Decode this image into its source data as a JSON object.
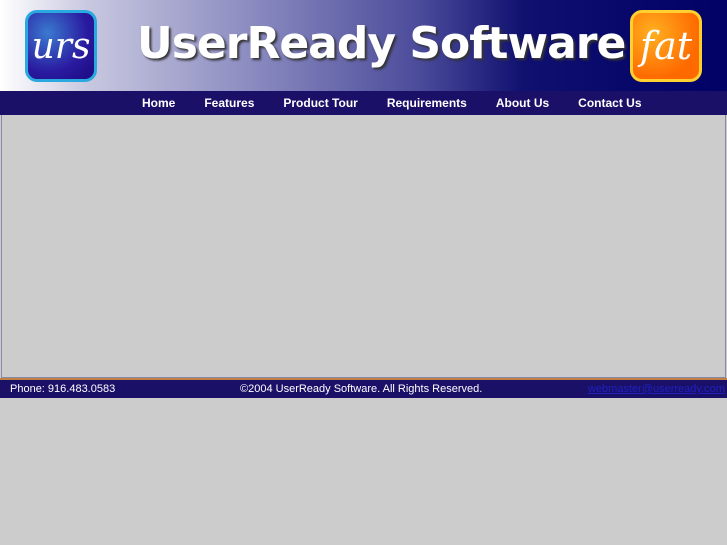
{
  "header": {
    "title": "UserReady Software",
    "logo_left": "urs",
    "logo_right": "fat"
  },
  "nav": [
    "Home",
    "Features",
    "Product Tour",
    "Requirements",
    "About Us",
    "Contact Us"
  ],
  "footer": {
    "phone": "Phone:  916.483.0583",
    "copyright": "©2004 UserReady Software. All Rights Reserved.",
    "email": "webmaster@userready.com"
  }
}
